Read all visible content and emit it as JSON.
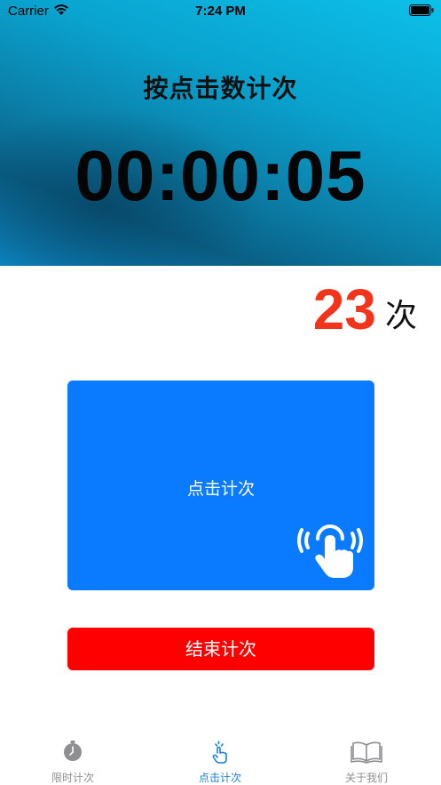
{
  "status_bar": {
    "carrier": "Carrier",
    "time": "7:24 PM"
  },
  "header": {
    "title": "按点击数计次",
    "timer": "00:00:05"
  },
  "counter": {
    "value": "23",
    "unit": "次"
  },
  "tap_button": {
    "label": "点击计次",
    "icon": "tap-hand-icon"
  },
  "end_button": {
    "label": "结束计次"
  },
  "tab_bar": {
    "tabs": [
      {
        "label": "限时计次",
        "icon": "stopwatch-icon",
        "active": false
      },
      {
        "label": "点击计次",
        "icon": "tap-icon",
        "active": true
      },
      {
        "label": "关于我们",
        "icon": "book-icon",
        "active": false
      }
    ]
  },
  "colors": {
    "accent_blue": "#0a7bff",
    "count_red": "#f2341a",
    "end_red": "#ff0000",
    "tab_active": "#1a7fe0",
    "tab_inactive": "#8e8e93"
  }
}
